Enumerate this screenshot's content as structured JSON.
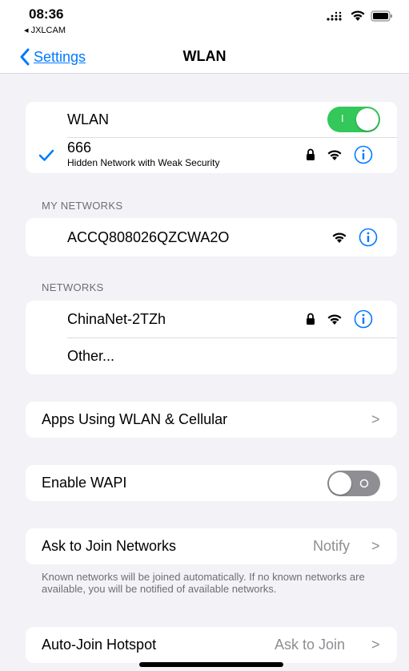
{
  "status": {
    "time": "08:36",
    "back_app": "◂ JXLCAM"
  },
  "nav": {
    "back_label": "Settings",
    "title": "WLAN"
  },
  "wlan": {
    "label": "WLAN",
    "toggle_text": "I",
    "toggle_on": true,
    "connected": {
      "name": "666",
      "subtitle": "Hidden Network with Weak Security"
    }
  },
  "my_networks": {
    "header": "MY NETWORKS",
    "items": [
      {
        "name": "ACCQ808026QZCWA2O"
      }
    ]
  },
  "networks": {
    "header": "NETWORKS",
    "items": [
      {
        "name": "ChinaNet-2TZh"
      }
    ],
    "other_label": "Other..."
  },
  "apps": {
    "label": "Apps Using WLAN & Cellular",
    "chevron": ">"
  },
  "wapi": {
    "label": "Enable WAPI",
    "toggle_on": false
  },
  "ask_join": {
    "label": "Ask to Join Networks",
    "value": "Notify",
    "chevron": ">",
    "note": "Known networks will be joined automatically. If no known networks are available, you will be notified of available networks."
  },
  "auto_hotspot": {
    "label": "Auto-Join Hotspot",
    "value": "Ask to Join",
    "chevron": ">"
  },
  "colors": {
    "accent": "#007aff",
    "toggle_on": "#34c759",
    "toggle_off": "#8e8e93",
    "background": "#f2f2f7"
  }
}
